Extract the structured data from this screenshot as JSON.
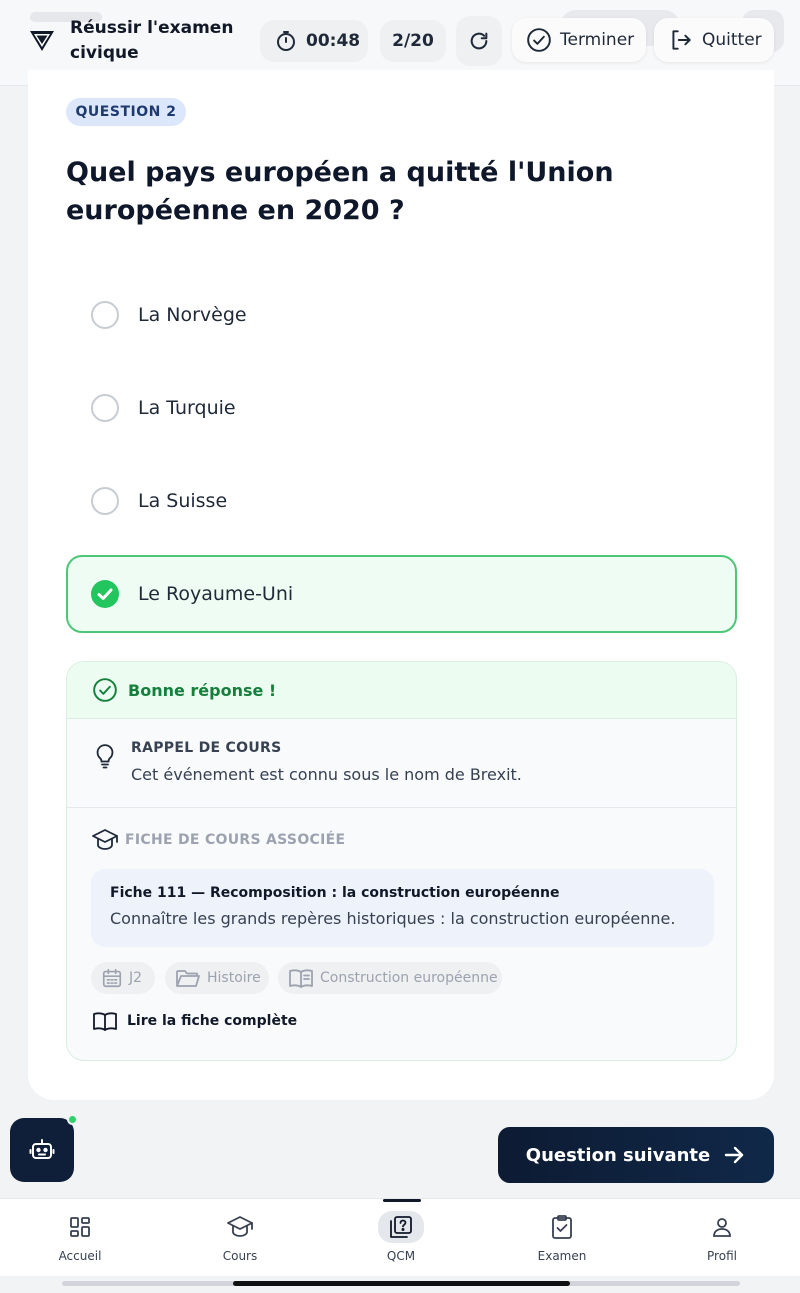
{
  "header": {
    "app_title": "Réussir l'examen civique",
    "timer": "00:48",
    "progress": "2/20",
    "finish_label": "Terminer",
    "quit_label": "Quitter"
  },
  "question": {
    "badge": "QUESTION 2",
    "text": "Quel pays européen a quitté l'Union européenne en 2020 ?",
    "options": [
      {
        "label": "La Norvège",
        "state": "unselected"
      },
      {
        "label": "La Turquie",
        "state": "unselected"
      },
      {
        "label": "La Suisse",
        "state": "unselected"
      },
      {
        "label": "Le Royaume-Uni",
        "state": "correct"
      }
    ]
  },
  "feedback": {
    "result": "Bonne réponse !",
    "reminder_title": "RAPPEL DE COURS",
    "reminder_text": "Cet événement est connu sous le nom de Brexit.",
    "sheet_header": "FICHE DE COURS ASSOCIÉE",
    "sheet_title": "Fiche 111 — Recomposition : la construction européenne",
    "sheet_desc": "Connaître les grands repères historiques : la construction européenne.",
    "tags": [
      "J2",
      "Histoire",
      "Construction européenne"
    ],
    "read_link": "Lire la fiche complète"
  },
  "actions": {
    "next_label": "Question suivante"
  },
  "nav": {
    "items": [
      {
        "label": "Accueil"
      },
      {
        "label": "Cours"
      },
      {
        "label": "QCM"
      },
      {
        "label": "Examen"
      },
      {
        "label": "Profil"
      }
    ],
    "active": "QCM"
  },
  "colors": {
    "accent_navy": "#0f1f3a",
    "success": "#22c55e",
    "success_text": "#15803d",
    "badge_bg": "#dde7fb"
  }
}
